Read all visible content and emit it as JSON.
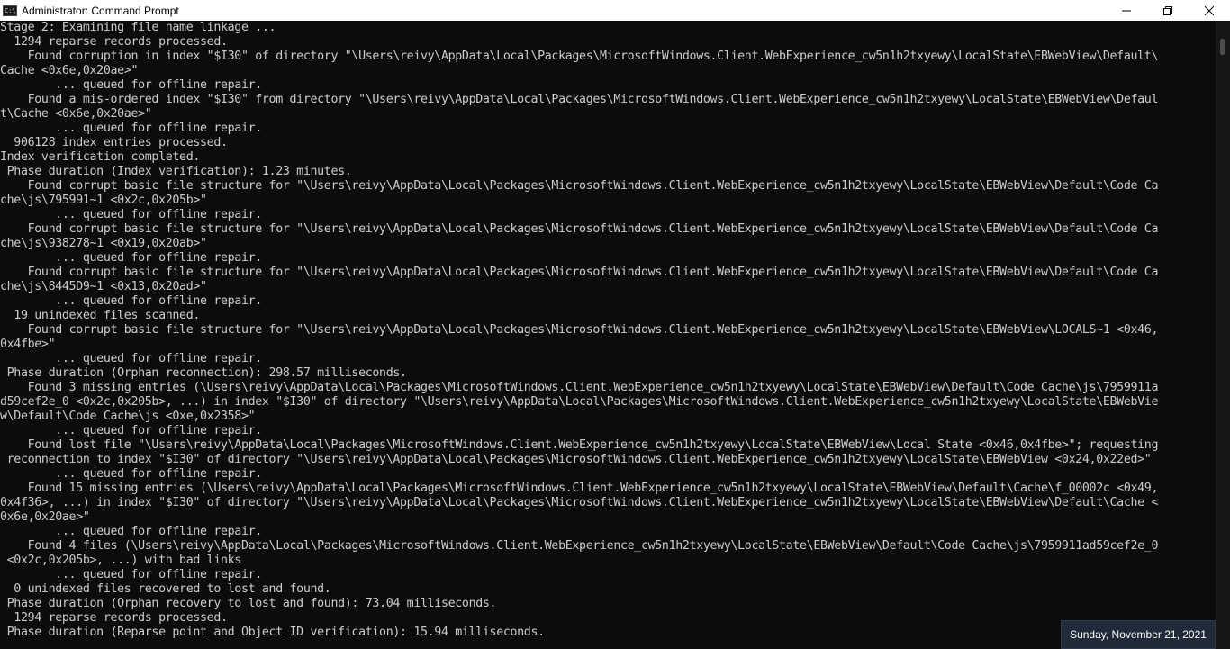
{
  "window": {
    "title": "Administrator: Command Prompt",
    "icon": "cmd-icon",
    "icon_glyph": "C:\\",
    "controls": [
      "minimize-icon",
      "maximize-icon",
      "close-icon"
    ]
  },
  "console": {
    "background": "#0c0c0c",
    "foreground": "#cccccc",
    "lines": [
      "Stage 2: Examining file name linkage ...",
      "  1294 reparse records processed.",
      "    Found corruption in index \"$I30\" of directory \"\\Users\\reivy\\AppData\\Local\\Packages\\MicrosoftWindows.Client.WebExperience_cw5n1h2txyewy\\LocalState\\EBWebView\\Default\\",
      "Cache <0x6e,0x20ae>\"",
      "        ... queued for offline repair.",
      "    Found a mis-ordered index \"$I30\" from directory \"\\Users\\reivy\\AppData\\Local\\Packages\\MicrosoftWindows.Client.WebExperience_cw5n1h2txyewy\\LocalState\\EBWebView\\Defaul",
      "t\\Cache <0x6e,0x20ae>\"",
      "        ... queued for offline repair.",
      "  906128 index entries processed.",
      "Index verification completed.",
      " Phase duration (Index verification): 1.23 minutes.",
      "    Found corrupt basic file structure for \"\\Users\\reivy\\AppData\\Local\\Packages\\MicrosoftWindows.Client.WebExperience_cw5n1h2txyewy\\LocalState\\EBWebView\\Default\\Code Ca",
      "che\\js\\795991~1 <0x2c,0x205b>\"",
      "        ... queued for offline repair.",
      "    Found corrupt basic file structure for \"\\Users\\reivy\\AppData\\Local\\Packages\\MicrosoftWindows.Client.WebExperience_cw5n1h2txyewy\\LocalState\\EBWebView\\Default\\Code Ca",
      "che\\js\\938278~1 <0x19,0x20ab>\"",
      "        ... queued for offline repair.",
      "    Found corrupt basic file structure for \"\\Users\\reivy\\AppData\\Local\\Packages\\MicrosoftWindows.Client.WebExperience_cw5n1h2txyewy\\LocalState\\EBWebView\\Default\\Code Ca",
      "che\\js\\8445D9~1 <0x13,0x20ad>\"",
      "        ... queued for offline repair.",
      "  19 unindexed files scanned.",
      "    Found corrupt basic file structure for \"\\Users\\reivy\\AppData\\Local\\Packages\\MicrosoftWindows.Client.WebExperience_cw5n1h2txyewy\\LocalState\\EBWebView\\LOCALS~1 <0x46,",
      "0x4fbe>\"",
      "        ... queued for offline repair.",
      " Phase duration (Orphan reconnection): 298.57 milliseconds.",
      "    Found 3 missing entries (\\Users\\reivy\\AppData\\Local\\Packages\\MicrosoftWindows.Client.WebExperience_cw5n1h2txyewy\\LocalState\\EBWebView\\Default\\Code Cache\\js\\7959911a",
      "d59cef2e_0 <0x2c,0x205b>, ...) in index \"$I30\" of directory \"\\Users\\reivy\\AppData\\Local\\Packages\\MicrosoftWindows.Client.WebExperience_cw5n1h2txyewy\\LocalState\\EBWebVie",
      "w\\Default\\Code Cache\\js <0xe,0x2358>\"",
      "        ... queued for offline repair.",
      "    Found lost file \"\\Users\\reivy\\AppData\\Local\\Packages\\MicrosoftWindows.Client.WebExperience_cw5n1h2txyewy\\LocalState\\EBWebView\\Local State <0x46,0x4fbe>\"; requesting",
      " reconnection to index \"$I30\" of directory \"\\Users\\reivy\\AppData\\Local\\Packages\\MicrosoftWindows.Client.WebExperience_cw5n1h2txyewy\\LocalState\\EBWebView <0x24,0x22ed>\"",
      "        ... queued for offline repair.",
      "    Found 15 missing entries (\\Users\\reivy\\AppData\\Local\\Packages\\MicrosoftWindows.Client.WebExperience_cw5n1h2txyewy\\LocalState\\EBWebView\\Default\\Cache\\f_00002c <0x49,",
      "0x4f36>, ...) in index \"$I30\" of directory \"\\Users\\reivy\\AppData\\Local\\Packages\\MicrosoftWindows.Client.WebExperience_cw5n1h2txyewy\\LocalState\\EBWebView\\Default\\Cache <",
      "0x6e,0x20ae>\"",
      "        ... queued for offline repair.",
      "    Found 4 files (\\Users\\reivy\\AppData\\Local\\Packages\\MicrosoftWindows.Client.WebExperience_cw5n1h2txyewy\\LocalState\\EBWebView\\Default\\Code Cache\\js\\7959911ad59cef2e_0",
      " <0x2c,0x205b>, ...) with bad links",
      "        ... queued for offline repair.",
      "  0 unindexed files recovered to lost and found.",
      " Phase duration (Orphan recovery to lost and found): 73.04 milliseconds.",
      "  1294 reparse records processed.",
      " Phase duration (Reparse point and Object ID verification): 15.94 milliseconds."
    ]
  },
  "taskbar_overlay": {
    "date": "Sunday, November 21, 2021"
  }
}
